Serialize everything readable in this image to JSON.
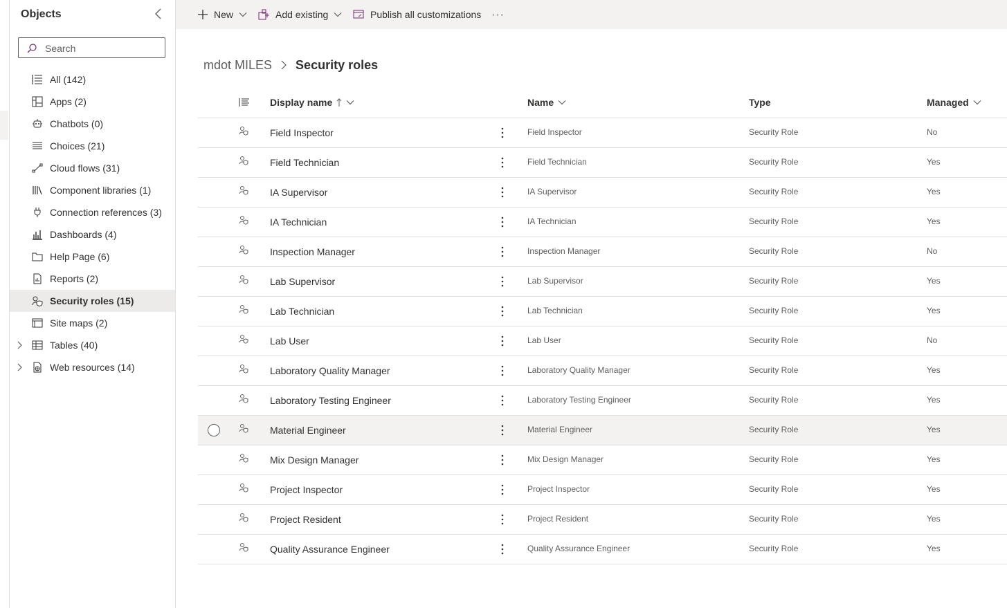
{
  "sidebar": {
    "title": "Objects",
    "search_placeholder": "Search",
    "items": [
      {
        "label": "All  (142)",
        "icon": "list-icon"
      },
      {
        "label": "Apps  (2)",
        "icon": "apps-icon"
      },
      {
        "label": "Chatbots  (0)",
        "icon": "bot-icon"
      },
      {
        "label": "Choices  (21)",
        "icon": "choices-icon"
      },
      {
        "label": "Cloud flows  (31)",
        "icon": "flow-icon"
      },
      {
        "label": "Component libraries  (1)",
        "icon": "library-icon"
      },
      {
        "label": "Connection references  (3)",
        "icon": "plug-icon"
      },
      {
        "label": "Dashboards  (4)",
        "icon": "dashboard-icon"
      },
      {
        "label": "Help Page  (6)",
        "icon": "folder-icon"
      },
      {
        "label": "Reports  (2)",
        "icon": "report-icon"
      },
      {
        "label": "Security roles  (15)",
        "icon": "security-role-icon"
      },
      {
        "label": "Site maps  (2)",
        "icon": "sitemap-icon"
      },
      {
        "label": "Tables  (40)",
        "icon": "table-icon"
      },
      {
        "label": "Web resources  (14)",
        "icon": "web-resource-icon"
      }
    ]
  },
  "toolbar": {
    "new_label": "New",
    "add_existing_label": "Add existing",
    "publish_label": "Publish all customizations",
    "more_label": "···"
  },
  "breadcrumb": {
    "root": "mdot MILES",
    "current": "Security roles"
  },
  "grid": {
    "columns": {
      "display_name": "Display name",
      "name": "Name",
      "type": "Type",
      "managed": "Managed"
    },
    "rows": [
      {
        "display": "Field Inspector",
        "name": "Field Inspector",
        "type": "Security Role",
        "managed": "No"
      },
      {
        "display": "Field Technician",
        "name": "Field Technician",
        "type": "Security Role",
        "managed": "Yes"
      },
      {
        "display": "IA Supervisor",
        "name": "IA Supervisor",
        "type": "Security Role",
        "managed": "Yes"
      },
      {
        "display": "IA Technician",
        "name": "IA Technician",
        "type": "Security Role",
        "managed": "Yes"
      },
      {
        "display": "Inspection Manager",
        "name": "Inspection Manager",
        "type": "Security Role",
        "managed": "No"
      },
      {
        "display": "Lab Supervisor",
        "name": "Lab Supervisor",
        "type": "Security Role",
        "managed": "Yes"
      },
      {
        "display": "Lab Technician",
        "name": "Lab Technician",
        "type": "Security Role",
        "managed": "Yes"
      },
      {
        "display": "Lab User",
        "name": "Lab User",
        "type": "Security Role",
        "managed": "No"
      },
      {
        "display": "Laboratory Quality Manager",
        "name": "Laboratory Quality Manager",
        "type": "Security Role",
        "managed": "Yes"
      },
      {
        "display": "Laboratory Testing Engineer",
        "name": "Laboratory Testing Engineer",
        "type": "Security Role",
        "managed": "Yes"
      },
      {
        "display": "Material Engineer",
        "name": "Material Engineer",
        "type": "Security Role",
        "managed": "Yes"
      },
      {
        "display": "Mix Design Manager",
        "name": "Mix Design Manager",
        "type": "Security Role",
        "managed": "Yes"
      },
      {
        "display": "Project Inspector",
        "name": "Project Inspector",
        "type": "Security Role",
        "managed": "Yes"
      },
      {
        "display": "Project Resident",
        "name": "Project Resident",
        "type": "Security Role",
        "managed": "Yes"
      },
      {
        "display": "Quality Assurance Engineer",
        "name": "Quality Assurance Engineer",
        "type": "Security Role",
        "managed": "Yes"
      }
    ]
  },
  "colors": {
    "accent": "#742774",
    "selected_bg": "#edebe9",
    "toolbar_bg": "#f3f2f1",
    "border": "#e1dfdd"
  }
}
